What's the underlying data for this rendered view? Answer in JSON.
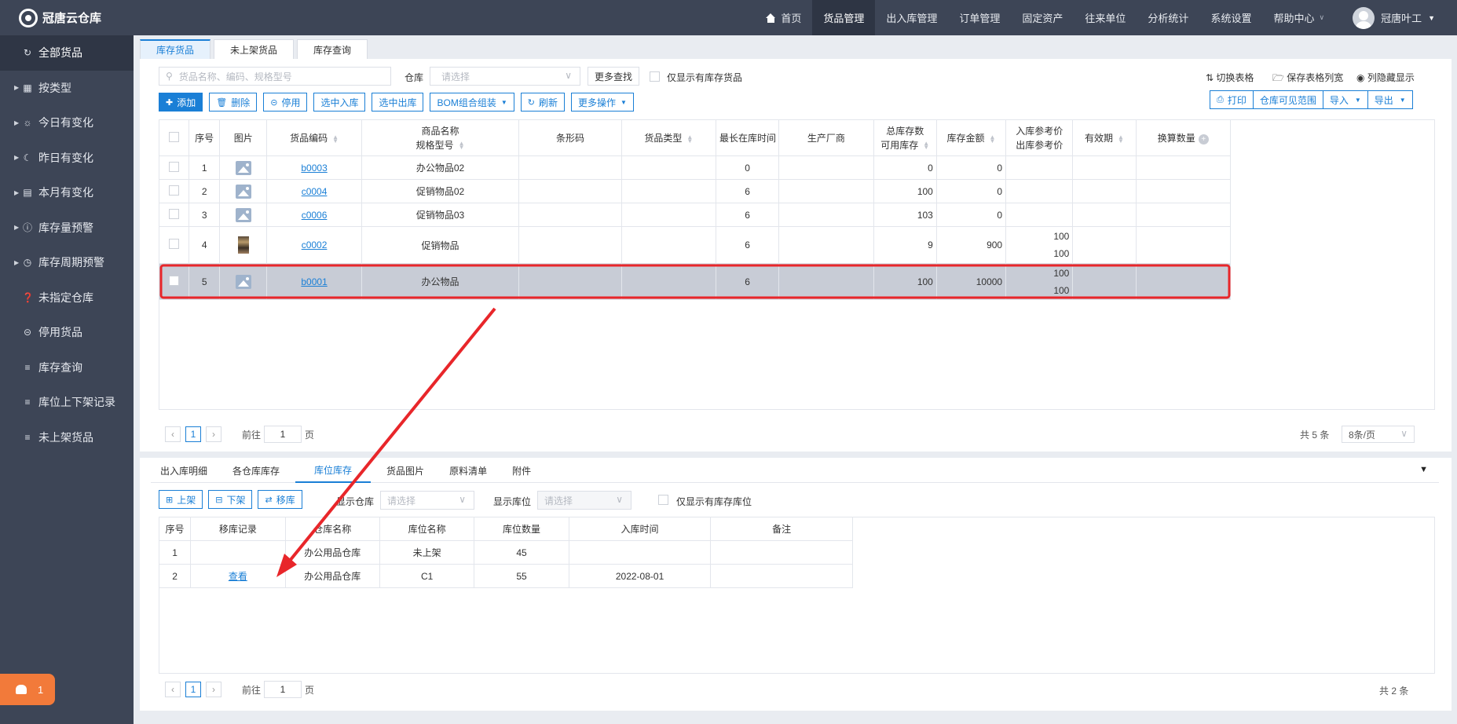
{
  "app": {
    "logo": "冠唐云仓库"
  },
  "nav": [
    {
      "label": "首页",
      "icon": "home-icon"
    },
    {
      "label": "货品管理",
      "active": true
    },
    {
      "label": "出入库管理"
    },
    {
      "label": "订单管理"
    },
    {
      "label": "固定资产"
    },
    {
      "label": "往来单位"
    },
    {
      "label": "分析统计"
    },
    {
      "label": "系统设置"
    },
    {
      "label": "帮助中心"
    }
  ],
  "user": {
    "name": "冠唐叶工"
  },
  "sidebar": [
    {
      "label": "全部货品",
      "icon": "refresh-icon",
      "active": true
    },
    {
      "label": "按类型",
      "icon": "grid-icon",
      "arrow": true
    },
    {
      "label": "今日有变化",
      "icon": "sun-icon",
      "arrow": true
    },
    {
      "label": "昨日有变化",
      "icon": "moon-icon",
      "arrow": true
    },
    {
      "label": "本月有变化",
      "icon": "calendar-icon",
      "arrow": true
    },
    {
      "label": "库存量预警",
      "icon": "alert-icon",
      "arrow": true
    },
    {
      "label": "库存周期预警",
      "icon": "clock-icon",
      "arrow": true
    },
    {
      "label": "未指定仓库",
      "icon": "question-icon"
    },
    {
      "label": "停用货品",
      "icon": "minus-circle-icon"
    },
    {
      "label": "库存查询",
      "icon": "list-icon"
    },
    {
      "label": "库位上下架记录",
      "icon": "list-icon"
    },
    {
      "label": "未上架货品",
      "icon": "list-icon"
    }
  ],
  "notify": {
    "count": "1"
  },
  "top_tabs": [
    {
      "label": "库存货品",
      "active": true
    },
    {
      "label": "未上架货品"
    },
    {
      "label": "库存查询"
    }
  ],
  "filter": {
    "search_placeholder": "货品名称、编码、规格型号",
    "warehouse_label": "仓库",
    "warehouse_placeholder": "请选择",
    "more_search": "更多查找",
    "only_stock": "仅显示有库存货品"
  },
  "right_tools": {
    "switch": "切换表格",
    "save": "保存表格列宽",
    "hide": "列隐藏显示"
  },
  "toolbar": {
    "add": "添加",
    "delete": "删除",
    "disable": "停用",
    "in": "选中入库",
    "out": "选中出库",
    "bom": "BOM组合组装",
    "refresh": "刷新",
    "more": "更多操作"
  },
  "right_buttons": {
    "print": "打印",
    "scope": "仓库可见范围",
    "import": "导入",
    "export": "导出"
  },
  "main_table": {
    "headers": {
      "seq": "序号",
      "img": "图片",
      "code": "货品编码",
      "name1": "商品名称",
      "name2": "规格型号",
      "barcode": "条形码",
      "type": "货品类型",
      "longest": "最长在库时间",
      "maker": "生产厂商",
      "total1": "总库存数",
      "total2": "可用库存",
      "amount": "库存金额",
      "price1": "入库参考价",
      "price2": "出库参考价",
      "expiry": "有效期",
      "convert": "换算数量"
    },
    "rows": [
      {
        "seq": "1",
        "code": "b0003",
        "name": "办公物品02",
        "longest": "0",
        "total": "0",
        "amount": "0",
        "in_price": "",
        "out_price": "",
        "img": "placeholder"
      },
      {
        "seq": "2",
        "code": "c0004",
        "name": "促销物品02",
        "longest": "6",
        "total": "100",
        "amount": "0",
        "in_price": "",
        "out_price": "",
        "img": "placeholder"
      },
      {
        "seq": "3",
        "code": "c0006",
        "name": "促销物品03",
        "longest": "6",
        "total": "103",
        "amount": "0",
        "in_price": "",
        "out_price": "",
        "img": "placeholder"
      },
      {
        "seq": "4",
        "code": "c0002",
        "name": "促销物品",
        "longest": "6",
        "total": "9",
        "amount": "900",
        "in_price": "100",
        "out_price": "100",
        "img": "photo"
      },
      {
        "seq": "5",
        "code": "b0001",
        "name": "办公物品",
        "longest": "6",
        "total": "100",
        "amount": "10000",
        "in_price": "100",
        "out_price": "100",
        "img": "placeholder",
        "selected": true
      }
    ]
  },
  "main_pager": {
    "page": "1",
    "goto": "前往",
    "goto_value": "1",
    "page_unit": "页",
    "total": "共 5 条",
    "per_page": "8条/页"
  },
  "bottom_tabs": [
    {
      "label": "出入库明细"
    },
    {
      "label": "各仓库库存"
    },
    {
      "label": "库位库存",
      "active": true
    },
    {
      "label": "货品图片"
    },
    {
      "label": "原料清单"
    },
    {
      "label": "附件"
    }
  ],
  "bottom_toolbar": {
    "shelve": "上架",
    "unshelve": "下架",
    "move": "移库",
    "show_wh": "显示仓库",
    "wh_placeholder": "请选择",
    "show_loc": "显示库位",
    "loc_placeholder": "请选择",
    "only_loc": "仅显示有库存库位"
  },
  "loc_table": {
    "headers": {
      "seq": "序号",
      "record": "移库记录",
      "wh": "仓库名称",
      "loc": "库位名称",
      "qty": "库位数量",
      "time": "入库时间",
      "note": "备注"
    },
    "rows": [
      {
        "seq": "1",
        "record": "",
        "wh": "办公用品仓库",
        "loc": "未上架",
        "qty": "45",
        "time": "",
        "note": ""
      },
      {
        "seq": "2",
        "record": "查看",
        "wh": "办公用品仓库",
        "loc": "C1",
        "qty": "55",
        "time": "2022-08-01",
        "note": ""
      }
    ]
  },
  "bottom_pager": {
    "page": "1",
    "goto": "前往",
    "goto_value": "1",
    "page_unit": "页",
    "total": "共 2 条"
  },
  "annotation": {
    "color": "#e8262a"
  }
}
